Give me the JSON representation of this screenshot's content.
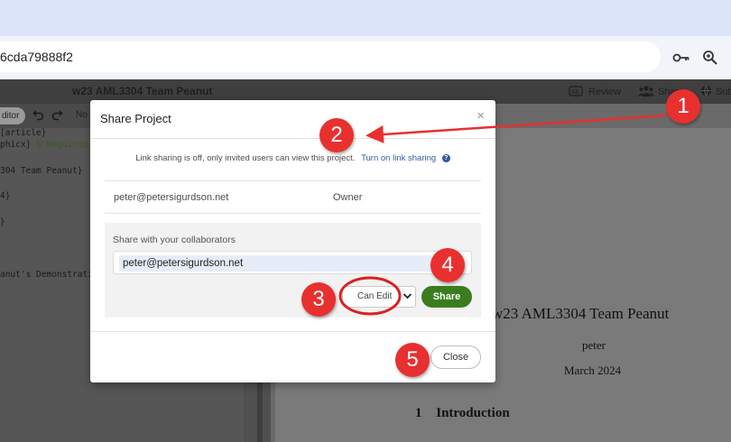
{
  "browser": {
    "url": "6cda79888f2",
    "icons": [
      "key-icon",
      "zoom-icon"
    ]
  },
  "toolbar": {
    "project_title": "w23 AML3304 Team Peanut",
    "review_label": "Review",
    "share_label": "Share",
    "submit_label": "Sub",
    "editor_toggle": "ditor",
    "no_label": "No"
  },
  "editor": {
    "lines": [
      {
        "text": "[article}",
        "comment": ""
      },
      {
        "text": "phicx} ",
        "comment": "% Required f"
      },
      {
        "text": "304 Team Peanut}",
        "comment": ""
      },
      {
        "text": "4}",
        "comment": ""
      },
      {
        "text": "}",
        "comment": ""
      },
      {
        "text": "anut's Demonstratio",
        "comment": ""
      }
    ]
  },
  "pdf": {
    "title": "w23 AML3304 Team Peanut",
    "author": "peter",
    "date": "March 2024",
    "section_number": "1",
    "section_title": "Introduction"
  },
  "modal": {
    "title": "Share Project",
    "close_symbol": "×",
    "link_sharing_text": "Link sharing is off, only invited users can view this project.",
    "link_sharing_action": "Turn on link sharing",
    "help_symbol": "?",
    "owner_email": "peter@petersigurdson.net",
    "owner_role": "Owner",
    "share_label": "Share with your collaborators",
    "collaborator_value": "peter@petersigurdson.net",
    "permission_value": "Can Edit",
    "share_button": "Share",
    "close_button": "Close"
  },
  "annotations": {
    "badges": [
      "1",
      "2",
      "3",
      "4",
      "5"
    ],
    "color": "#e8302f"
  },
  "colors": {
    "share_green": "#3a7d1d",
    "link_blue": "#2d5aa0",
    "tab_strip": "#dbe4f9"
  }
}
